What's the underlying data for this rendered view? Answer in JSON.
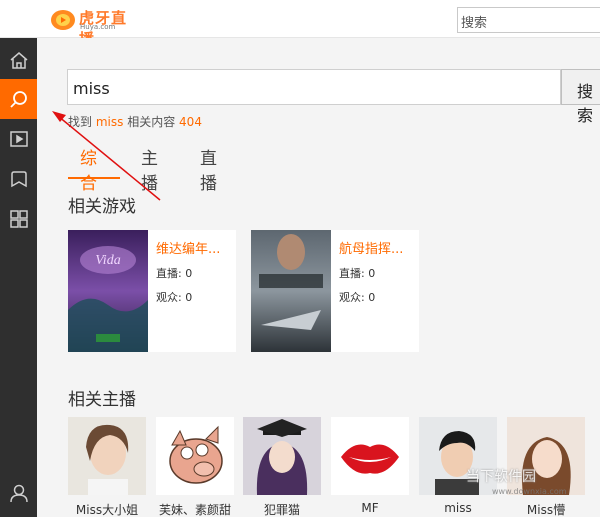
{
  "header": {
    "logo_text": "虎牙直播",
    "logo_sub": "Huya.com",
    "search_text": "搜索"
  },
  "sidebar": {
    "items": [
      {
        "icon": "home-icon"
      },
      {
        "icon": "search-icon",
        "active": true
      },
      {
        "icon": "video-icon"
      },
      {
        "icon": "bookmark-icon"
      },
      {
        "icon": "grid-icon"
      },
      {
        "icon": "user-icon"
      }
    ]
  },
  "search": {
    "value": "miss",
    "button_label": "搜索"
  },
  "result": {
    "prefix": "找到",
    "keyword": "miss",
    "middle": "相关内容",
    "count": "404"
  },
  "tabs": [
    {
      "label": "综合",
      "active": true
    },
    {
      "label": "主播",
      "active": false
    },
    {
      "label": "直播",
      "active": false
    }
  ],
  "games_section": {
    "title": "相关游戏",
    "items": [
      {
        "name": "维达编年...",
        "live": "直播: 0",
        "viewers": "观众: 0"
      },
      {
        "name": "航母指挥...",
        "live": "直播: 0",
        "viewers": "观众: 0"
      }
    ]
  },
  "streamers_section": {
    "title": "相关主播",
    "items": [
      {
        "name": "Miss大小姐"
      },
      {
        "name": "芙妹、素颜甜"
      },
      {
        "name": "犯罪猫"
      },
      {
        "name": "MF"
      },
      {
        "name": "miss"
      },
      {
        "name": "Miss懵"
      }
    ]
  },
  "watermark": {
    "text": "当下软件园",
    "sub": "www.downxia.com"
  },
  "colors": {
    "accent": "#ff6a00",
    "sidebar": "#2f2f2f"
  }
}
